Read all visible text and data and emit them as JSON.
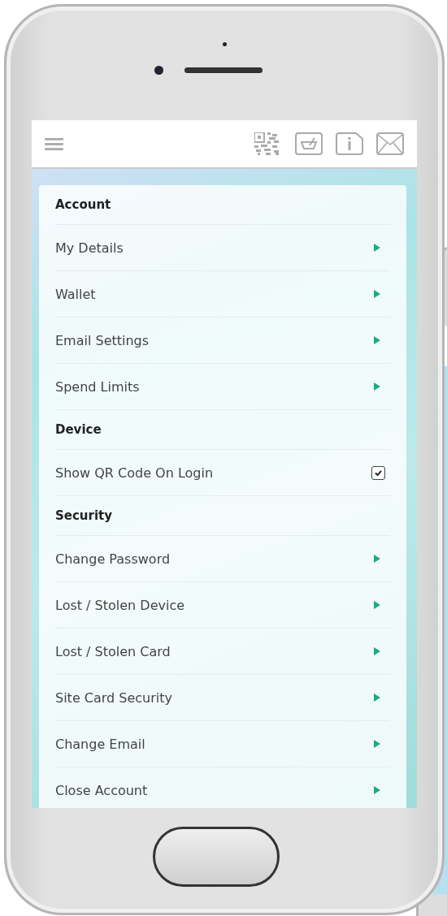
{
  "sections": [
    {
      "title": "Account",
      "items": [
        {
          "kind": "link",
          "label": "My Details"
        },
        {
          "kind": "link",
          "label": "Wallet"
        },
        {
          "kind": "link",
          "label": "Email Settings"
        },
        {
          "kind": "link",
          "label": "Spend Limits"
        }
      ]
    },
    {
      "title": "Device",
      "items": [
        {
          "kind": "checkbox",
          "label": "Show QR Code On Login",
          "checked": true
        }
      ]
    },
    {
      "title": "Security",
      "items": [
        {
          "kind": "link",
          "label": "Change Password"
        },
        {
          "kind": "link",
          "label": "Lost / Stolen Device"
        },
        {
          "kind": "link",
          "label": "Lost / Stolen Card"
        },
        {
          "kind": "link",
          "label": "Site Card Security"
        },
        {
          "kind": "link",
          "label": "Change Email"
        },
        {
          "kind": "link",
          "label": "Close Account"
        }
      ]
    }
  ]
}
